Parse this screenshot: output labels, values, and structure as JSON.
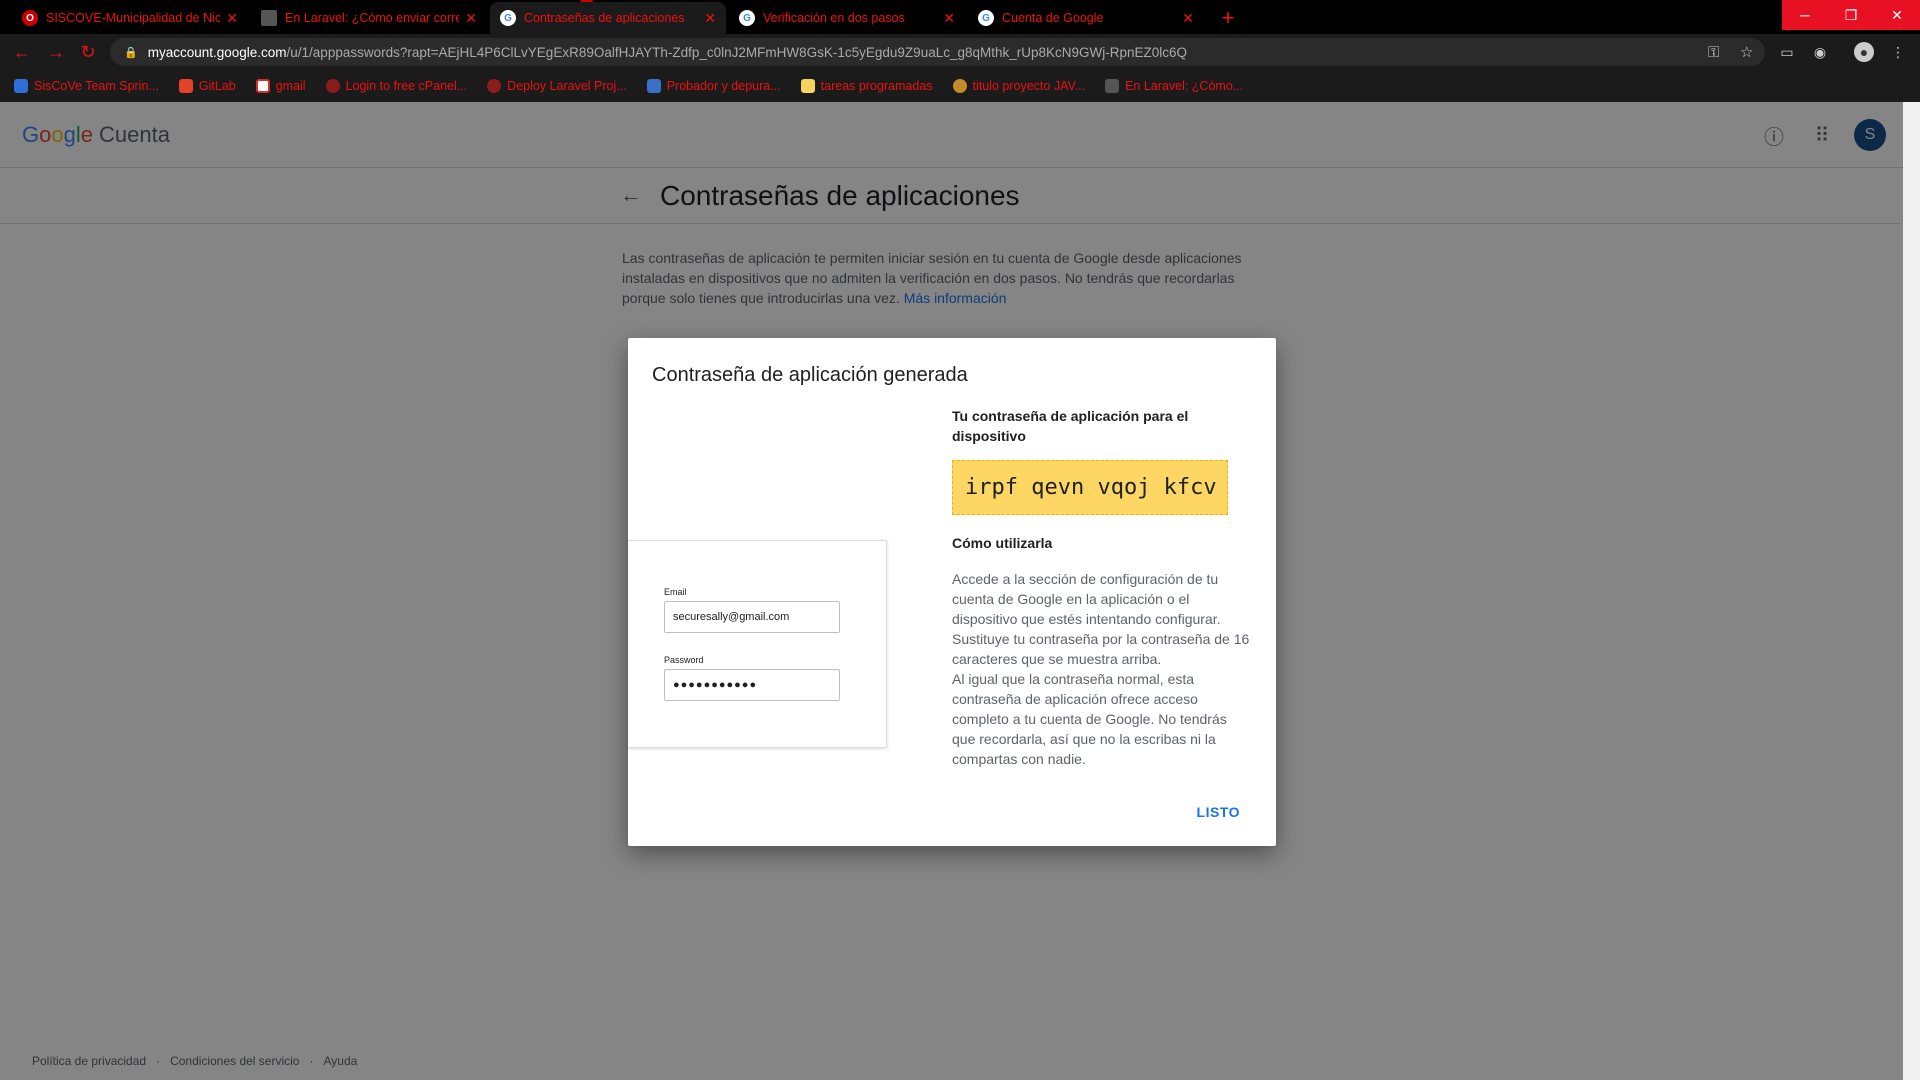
{
  "browser": {
    "tabs": [
      {
        "title": "SISCOVE-Municipalidad de Nicoya",
        "icon": "opera-icon"
      },
      {
        "title": "En Laravel: ¿Cómo enviar correos",
        "icon": "page-icon"
      },
      {
        "title": "Contraseñas de aplicaciones",
        "icon": "google-icon"
      },
      {
        "title": "Verificación en dos pasos",
        "icon": "google-icon"
      },
      {
        "title": "Cuenta de Google",
        "icon": "google-icon"
      }
    ],
    "address": {
      "host": "myaccount.google.com",
      "path": "/u/1/apppasswords?rapt=AEjHL4P6ClLvYEgExR89OalfHJAYTh-Zdfp_c0lnJ2MFmHW8GsK-1c5yEgdu9Z9uaLc_g8qMthk_rUp8KcN9GWj-RpnEZ0lc6Q"
    },
    "bookmarks": [
      "SisCoVe Team Sprin...",
      "GitLab",
      "gmail",
      "Login to free cPanel...",
      "Deploy Laravel Proj...",
      "Probador y depura...",
      "tareas programadas",
      "titulo proyecto JAV...",
      "En Laravel: ¿Cómo..."
    ],
    "accent_color": "#e11111"
  },
  "header": {
    "logo": [
      "G",
      "o",
      "o",
      "g",
      "l",
      "e"
    ],
    "product": "Cuenta",
    "avatar_letter": "S"
  },
  "page": {
    "title": "Contraseñas de aplicaciones",
    "intro": "Las contraseñas de aplicación te permiten iniciar sesión en tu cuenta de Google desde aplicaciones instaladas en dispositivos que no admiten la verificación en dos pasos. No tendrás que recordarlas porque solo tienes que introducirlas una vez.",
    "intro_link": "Más información"
  },
  "dialog": {
    "title": "Contraseña de aplicación generada",
    "illustration": {
      "email_label": "Email",
      "email_value": "securesally@gmail.com",
      "password_label": "Password",
      "password_value": "●●●●●●●●●●●"
    },
    "device_heading": "Tu contraseña de aplicación para el dispositivo",
    "app_password": "irpf qevn vqoj kfcv",
    "how_heading": "Cómo utilizarla",
    "instructions_1": "Accede a la sección de configuración de tu cuenta de Google en la aplicación o el dispositivo que estés intentando configurar. Sustituye tu contraseña por la contraseña de 16 caracteres que se muestra arriba.",
    "instructions_2": "Al igual que la contraseña normal, esta contraseña de aplicación ofrece acceso completo a tu cuenta de Google. No tendrás que recordarla, así que no la escribas ni la compartas con nadie.",
    "done_label": "LISTO",
    "password_highlight": "#fdd663"
  },
  "footer": {
    "links": [
      "Política de privacidad",
      "Condiciones del servicio",
      "Ayuda"
    ]
  }
}
